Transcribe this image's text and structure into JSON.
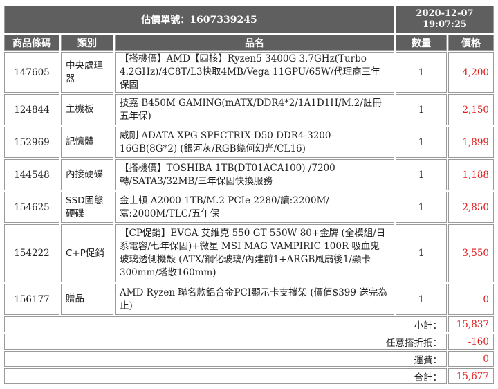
{
  "header": {
    "quote_label": "估價單號：1607339245",
    "date": "2020-12-07",
    "time": "19:07:25"
  },
  "columns": {
    "code": "商品條碼",
    "category": "類別",
    "name": "品名",
    "qty": "數量",
    "price": "價格"
  },
  "items": [
    {
      "code": "147605",
      "category": "中央處理器",
      "name": "【搭機價】AMD【四核】Ryzen5 3400G 3.7GHz(Turbo 4.2GHz)/4C8T/L3快取4MB/Vega 11GPU/65W/代理商三年保固",
      "qty": "1",
      "price": "4,200"
    },
    {
      "code": "124844",
      "category": "主機板",
      "name": "技嘉 B450M GAMING(mATX/DDR4*2/1A1D1H/M.2/註冊五年保)",
      "qty": "1",
      "price": "2,150"
    },
    {
      "code": "152969",
      "category": "記憶體",
      "name": "威剛 ADATA XPG SPECTRIX D50 DDR4-3200-16GB(8G*2) (銀河灰/RGB幾何幻光/CL16)",
      "qty": "1",
      "price": "1,899"
    },
    {
      "code": "144548",
      "category": "內接硬碟",
      "name": "【搭機價】TOSHIBA 1TB(DT01ACA100) /7200轉/SATA3/32MB/三年保固快換服務",
      "qty": "1",
      "price": "1,188"
    },
    {
      "code": "154625",
      "category": "SSD固態硬碟",
      "name": "金士頓 A2000 1TB/M.2 PCIe 2280/讀:2200M/寫:2000M/TLC/五年保",
      "qty": "1",
      "price": "2,850"
    },
    {
      "code": "154222",
      "category": "C+P促銷",
      "name": "【CP促銷】EVGA 艾維克 550 GT 550W 80+金牌 (全模組/日系電容/七年保固)+微星 MSI MAG VAMPIRIC 100R 吸血鬼 玻璃透側機殼 (ATX/鋼化玻璃/內建前1+ARGB風扇後1/顯卡300mm/塔散160mm)",
      "qty": "1",
      "price": "3,550"
    },
    {
      "code": "156177",
      "category": "贈品",
      "name": "AMD Ryzen 聯名款鋁合金PCI顯示卡支撐架 (價值$399 送完為止)",
      "qty": "1",
      "price": "0"
    }
  ],
  "summary": [
    {
      "label": "小計：",
      "value": "15,837"
    },
    {
      "label": "任意搭折抵：",
      "value": "-160"
    },
    {
      "label": "運費：",
      "value": "0"
    },
    {
      "label": "合計：",
      "value": "15,677"
    }
  ]
}
